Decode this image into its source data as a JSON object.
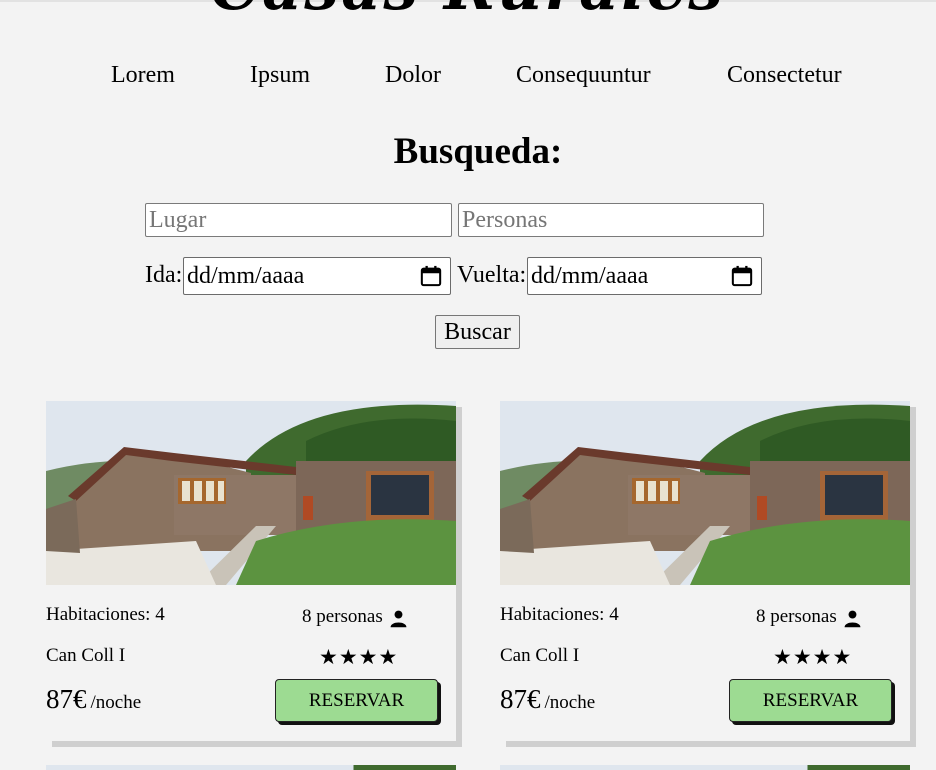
{
  "site": {
    "logo": "Casas Rurales"
  },
  "nav": [
    "Lorem",
    "Ipsum",
    "Dolor",
    "Consequuntur",
    "Consectetur"
  ],
  "search": {
    "title": "Busqueda:",
    "place_placeholder": "Lugar",
    "people_placeholder": "Personas",
    "checkin_label": "Ida:",
    "checkin_value": "dd/mm/aaaa",
    "checkout_label": "Vuelta:",
    "checkout_value": "dd/mm/aaaa",
    "button": "Buscar"
  },
  "listings": [
    {
      "rooms": "Habitaciones: 4",
      "people": "8 personas",
      "name": "Can Coll I",
      "stars": "★★★★",
      "rating": 4,
      "price": "87€",
      "unit": "/noche",
      "button": "RESERVAR"
    },
    {
      "rooms": "Habitaciones: 4",
      "people": "8 personas",
      "name": "Can Coll I",
      "stars": "★★★★",
      "rating": 4,
      "price": "87€",
      "unit": "/noche",
      "button": "RESERVAR"
    }
  ],
  "colors": {
    "background": "#f3f3f3",
    "reserve_button": "#9ddb92"
  },
  "icons": {
    "person": "person-icon",
    "calendar": "calendar-icon"
  }
}
